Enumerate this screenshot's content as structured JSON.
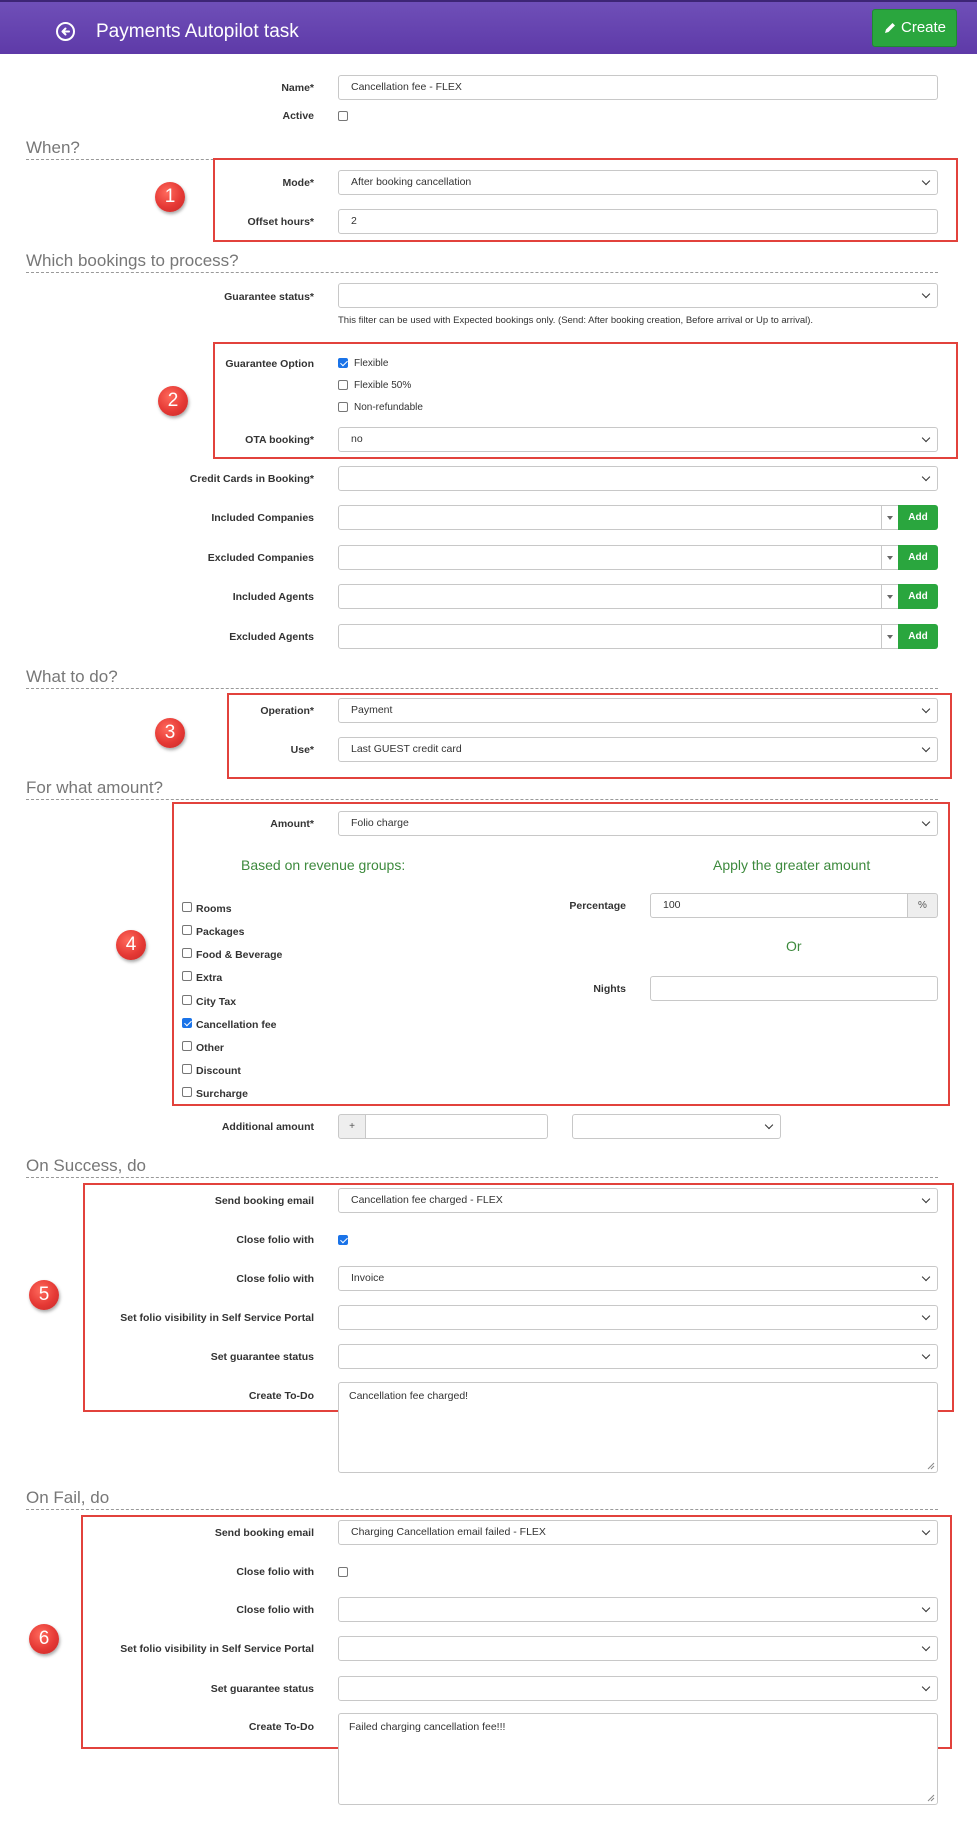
{
  "header": {
    "title": "Payments Autopilot task",
    "create_label": "Create",
    "colors": {
      "bar": "#5e3aa8",
      "create": "#2aa63e"
    }
  },
  "general": {
    "name_label": "Name*",
    "name_value": "Cancellation fee - FLEX",
    "active_label": "Active",
    "active_checked": false
  },
  "when": {
    "section_title": "When?",
    "mode_label": "Mode*",
    "mode_value": "After booking cancellation",
    "offset_label": "Offset hours*",
    "offset_value": "2"
  },
  "which": {
    "section_title": "Which bookings to process?",
    "guarantee_status_label": "Guarantee status*",
    "guarantee_status_value": "",
    "guarantee_status_help": "This filter can be used with Expected bookings only. (Send: After booking creation, Before arrival or Up to arrival).",
    "guarantee_option_label": "Guarantee Option",
    "guarantee_options": [
      {
        "label": "Flexible",
        "checked": true
      },
      {
        "label": "Flexible 50%",
        "checked": false
      },
      {
        "label": "Non-refundable",
        "checked": false
      }
    ],
    "ota_label": "OTA booking*",
    "ota_value": "no",
    "credit_cards_label": "Credit Cards in Booking*",
    "credit_cards_value": "",
    "included_companies_label": "Included Companies",
    "excluded_companies_label": "Excluded Companies",
    "included_agents_label": "Included Agents",
    "excluded_agents_label": "Excluded Agents",
    "add_label": "Add"
  },
  "what": {
    "section_title": "What to do?",
    "operation_label": "Operation*",
    "operation_value": "Payment",
    "use_label": "Use*",
    "use_value": "Last GUEST credit card"
  },
  "amount": {
    "section_title": "For what amount?",
    "amount_label": "Amount*",
    "amount_value": "Folio charge",
    "revenue_heading": "Based on revenue groups:",
    "greater_heading": "Apply the greater amount",
    "revenue_groups": [
      {
        "label": "Rooms",
        "checked": false
      },
      {
        "label": "Packages",
        "checked": false
      },
      {
        "label": "Food & Beverage",
        "checked": false
      },
      {
        "label": "Extra",
        "checked": false
      },
      {
        "label": "City Tax",
        "checked": false
      },
      {
        "label": "Cancellation fee",
        "checked": true
      },
      {
        "label": "Other",
        "checked": false
      },
      {
        "label": "Discount",
        "checked": false
      },
      {
        "label": "Surcharge",
        "checked": false
      }
    ],
    "percentage_label": "Percentage",
    "percentage_value": "100",
    "percent_symbol": "%",
    "or_label": "Or",
    "nights_label": "Nights",
    "nights_value": "",
    "additional_label": "Additional amount",
    "additional_sign": "+",
    "additional_value": ""
  },
  "success": {
    "section_title": "On Success, do",
    "send_email_label": "Send booking email",
    "send_email_value": "Cancellation fee charged - FLEX",
    "close_folio_label": "Close folio with",
    "close_folio_checked": true,
    "close_folio_with_label": "Close folio with",
    "close_folio_with_value": "Invoice",
    "visibility_label": "Set folio visibility in Self Service Portal",
    "visibility_value": "",
    "guarantee_label": "Set guarantee status",
    "guarantee_value": "",
    "todo_label": "Create To-Do",
    "todo_value": "Cancellation fee charged!"
  },
  "fail": {
    "section_title": "On Fail, do",
    "send_email_label": "Send booking email",
    "send_email_value": "Charging Cancellation email failed - FLEX",
    "close_folio_label": "Close folio with",
    "close_folio_checked": false,
    "close_folio_with_label": "Close folio with",
    "close_folio_with_value": "",
    "visibility_label": "Set folio visibility in Self Service Portal",
    "visibility_value": "",
    "guarantee_label": "Set guarantee status",
    "guarantee_value": "",
    "todo_label": "Create To-Do",
    "todo_value": "Failed charging cancellation fee!!!"
  },
  "markers": [
    "1",
    "2",
    "3",
    "4",
    "5",
    "6"
  ]
}
